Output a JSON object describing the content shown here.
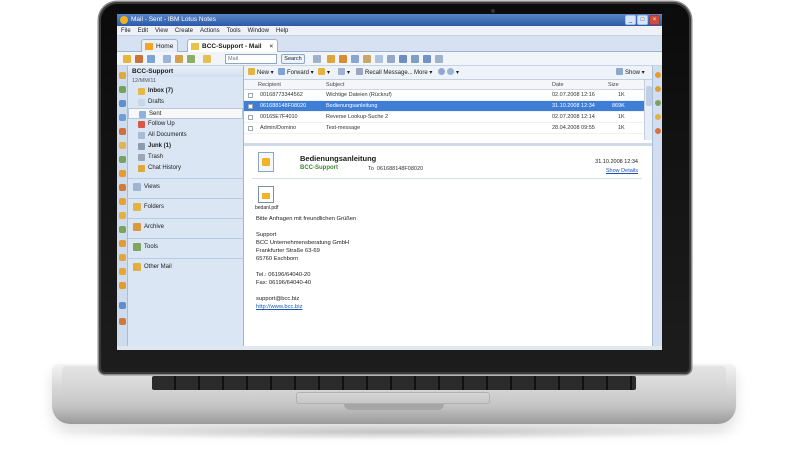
{
  "window": {
    "title": "Mail - Sent - IBM Lotus Notes",
    "controls": [
      "_",
      "□",
      "×"
    ]
  },
  "menu": [
    "File",
    "Edit",
    "View",
    "Create",
    "Actions",
    "Tools",
    "Window",
    "Help"
  ],
  "tabs": [
    {
      "label": "Home"
    },
    {
      "label": "BCC-Support - Mail",
      "close": "×"
    }
  ],
  "toolbar": {
    "search_placeholder": "Mail",
    "search_button": "Search"
  },
  "navigator": {
    "title": "BCC-Support",
    "date": "12/MM/11",
    "folders": [
      {
        "label": "Inbox (7)",
        "bold": true
      },
      {
        "label": "Drafts"
      },
      {
        "label": "Sent",
        "selected": true
      },
      {
        "label": "Follow Up"
      },
      {
        "label": "All Documents"
      },
      {
        "label": "Junk (1)",
        "bold": true
      },
      {
        "label": "Trash"
      },
      {
        "label": "Chat History"
      }
    ],
    "sections": [
      "Views",
      "Folders",
      "Archive",
      "Tools",
      "Other Mail"
    ]
  },
  "actions": {
    "new": "New",
    "forward": "Forward",
    "recall": "Recall Message",
    "more": "More",
    "show": "Show"
  },
  "list": {
    "columns": {
      "recipient": "Recipient",
      "subject": "Subject",
      "date": "Date",
      "size": "Size"
    },
    "rows": [
      {
        "recipient": "00168773344562",
        "subject": "Wichtige Dateien (Rückruf)",
        "date": "02.07.2008 12:16",
        "size": "1K",
        "selected": false
      },
      {
        "recipient": "061688148F08020",
        "subject": "Bedienungsanleitung",
        "date": "31.10.2008 12:34",
        "size": "869K",
        "selected": true
      },
      {
        "recipient": "00165E7F4010",
        "subject": "Reverse Lookup-Suche 2",
        "date": "02.07.2008 12:14",
        "size": "1K",
        "selected": false
      },
      {
        "recipient": "Admin/Domino",
        "subject": "Test-message",
        "date": "28.04.2008 09:55",
        "size": "1K",
        "selected": false
      }
    ]
  },
  "preview": {
    "subject": "Bedienungsanleitung",
    "from": "BCC-Support",
    "to_label": "To",
    "to": "061688148F08020",
    "date": "31.10.2008 12:34",
    "details_link": "Show Details",
    "attachment": "bedanl.pdf",
    "body": [
      "Bitte Anfragen mit freundlichen Grüßen",
      "",
      "Support",
      "BCC Unternehmensberatung GmbH",
      "Frankfurter Straße 63-69",
      "65760 Eschborn",
      "",
      "Tel.: 06196/64040-20",
      "Fax: 06196/64040-40",
      "",
      "support@bcc.biz"
    ],
    "website": "http://www.bcc.biz"
  },
  "colors": {
    "title_bar": "#2a5aa7",
    "selection": "#3f7ed6",
    "sender_green": "#3c8a2e",
    "link_blue": "#1b57b8"
  }
}
